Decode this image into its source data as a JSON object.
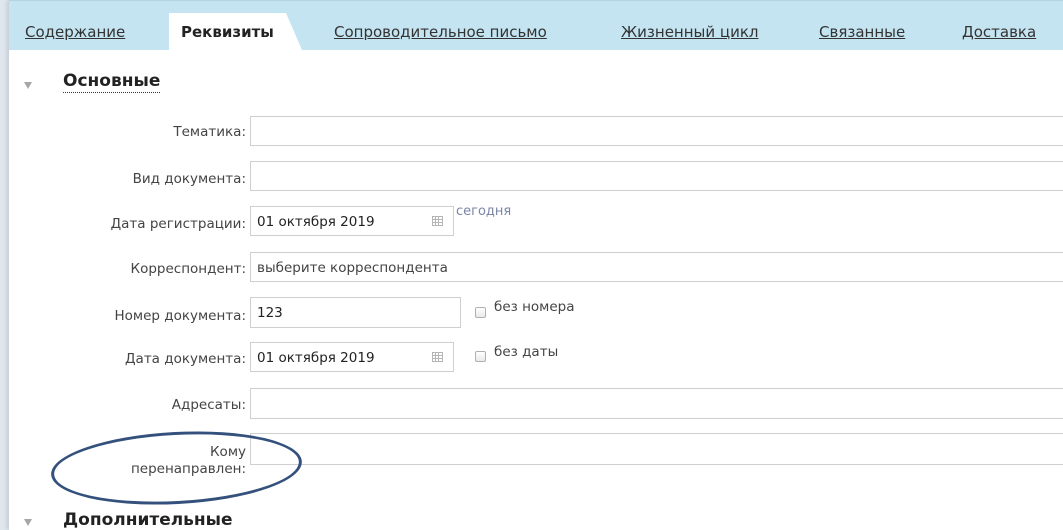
{
  "tabs": [
    {
      "label": "Содержание"
    },
    {
      "label": "Реквизиты",
      "active": true
    },
    {
      "label": "Сопроводительное письмо"
    },
    {
      "label": "Жизненный цикл"
    },
    {
      "label": "Связанные"
    },
    {
      "label": "Доставка"
    }
  ],
  "sections": {
    "main_title": "Основные",
    "extra_title": "Дополнительные"
  },
  "form": {
    "subject": {
      "label": "Тематика:",
      "value": ""
    },
    "doc_type": {
      "label": "Вид документа:",
      "value": ""
    },
    "reg_date": {
      "label": "Дата регистрации:",
      "value": "01 октября 2019",
      "today_link": "сегодня"
    },
    "correspondent": {
      "label": "Корреспондент:",
      "placeholder": "выберите корреспондента"
    },
    "doc_number": {
      "label": "Номер документа:",
      "value": "123",
      "no_number_label": "без номера",
      "no_number_checked": false
    },
    "doc_date": {
      "label": "Дата документа:",
      "value": "01 октября 2019",
      "no_date_label": "без даты",
      "no_date_checked": false
    },
    "addressees": {
      "label": "Адресаты:",
      "value": ""
    },
    "redirected_to": {
      "label_line1": "Кому",
      "label_line2": "перенаправлен:",
      "value": ""
    }
  },
  "colors": {
    "tabbar_bg": "#c4e4f1",
    "annotation": "#34507c",
    "link": "#7a86a6"
  },
  "icons": {
    "collapse": "triangle-down-icon",
    "calendar": "calendar-icon",
    "checkbox": "checkbox-icon"
  }
}
